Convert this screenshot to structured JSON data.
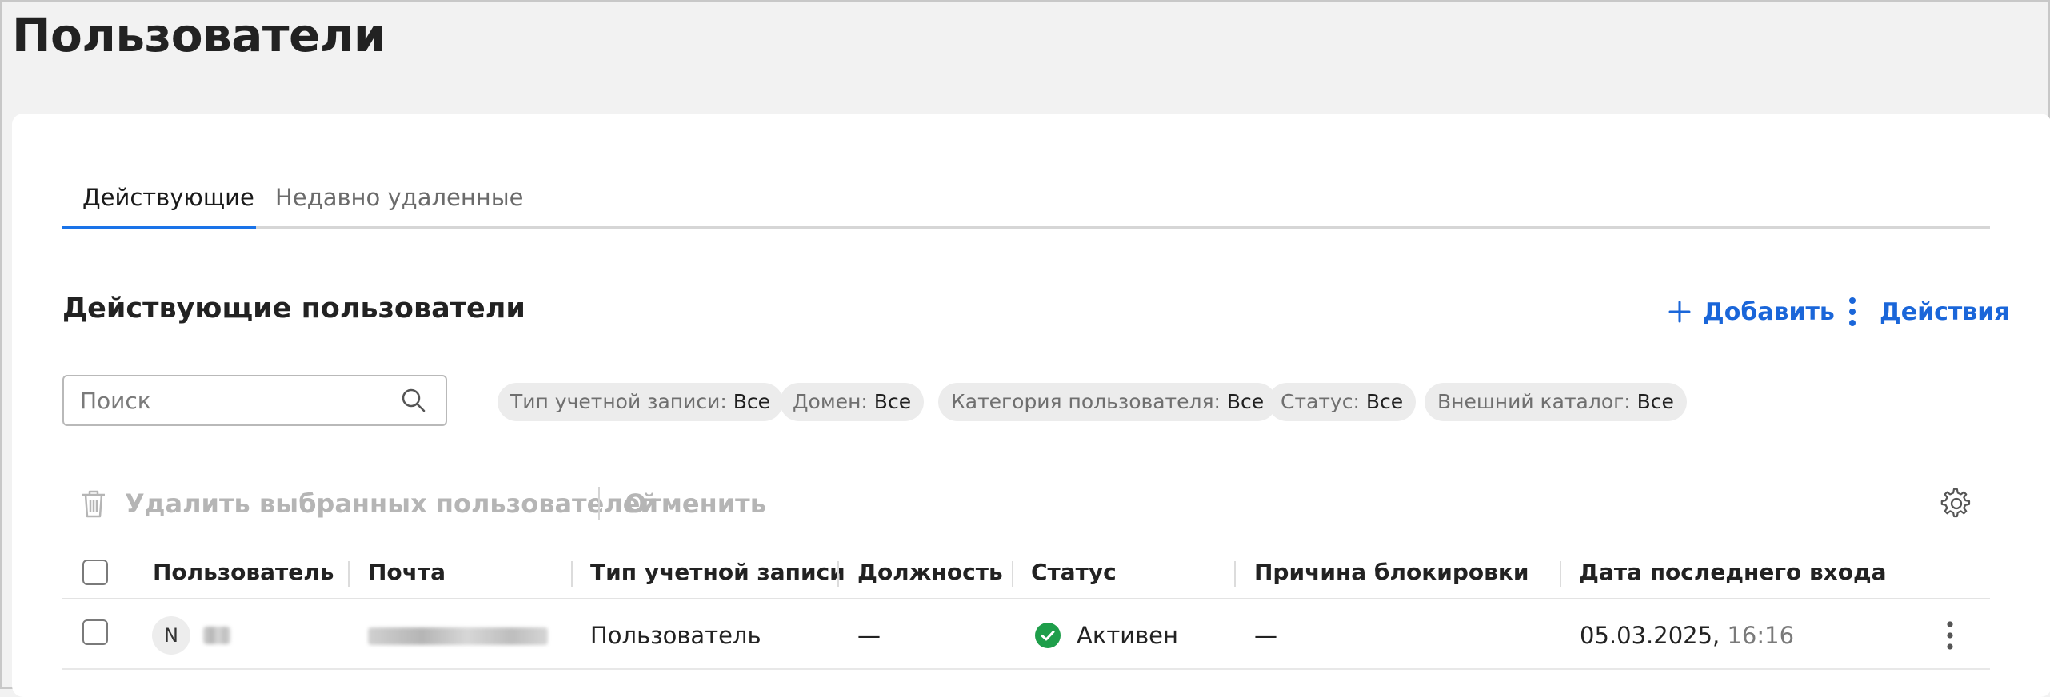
{
  "page": {
    "title": "Пользователи"
  },
  "tabs": [
    {
      "label": "Действующие",
      "active": true
    },
    {
      "label": "Недавно удаленные",
      "active": false
    }
  ],
  "section": {
    "title": "Действующие пользователи",
    "add_label": "Добавить",
    "actions_label": "Действия"
  },
  "search": {
    "placeholder": "Поиск",
    "value": ""
  },
  "filters": [
    {
      "name": "Тип учетной записи:",
      "value": "Все"
    },
    {
      "name": "Домен:",
      "value": "Все"
    },
    {
      "name": "Категория пользователя:",
      "value": "Все"
    },
    {
      "name": "Статус:",
      "value": "Все"
    },
    {
      "name": "Внешний каталог:",
      "value": "Все"
    }
  ],
  "bulk_actions": {
    "delete_label": "Удалить выбранных пользователей",
    "cancel_label": "Отменить"
  },
  "table": {
    "columns": [
      "Пользователь",
      "Почта",
      "Тип учетной записи",
      "Должность",
      "Статус",
      "Причина блокировки",
      "Дата последнего входа"
    ],
    "rows": [
      {
        "avatar_initial": "N",
        "account_type": "Пользователь",
        "position": "—",
        "status": "Активен",
        "block_reason": "—",
        "last_login_date": "05.03.2025,",
        "last_login_time": "16:16"
      }
    ]
  },
  "colors": {
    "accent": "#1a66d9",
    "tab_underline": "#1a73e8",
    "status_active": "#1e9e4a"
  },
  "icons": [
    "plus-icon",
    "kebab-icon",
    "search-icon",
    "trash-icon",
    "gear-icon",
    "check-icon"
  ]
}
